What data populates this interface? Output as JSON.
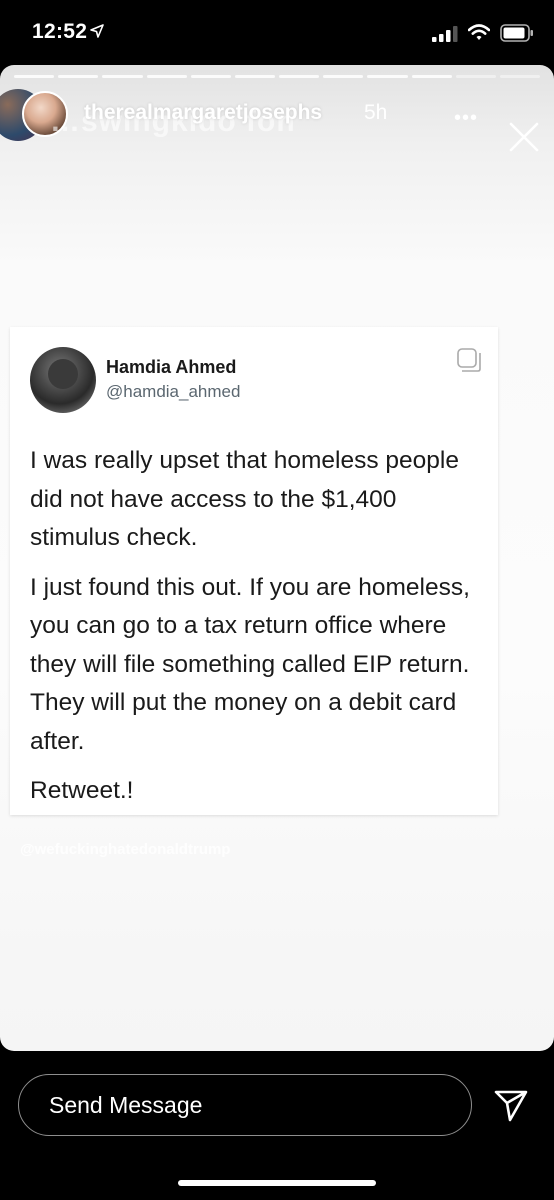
{
  "status_bar": {
    "time": "12:52"
  },
  "story": {
    "username": "therealmargaretjosephs",
    "time_ago": "5h",
    "ghost_text": "…swingkido  fon",
    "segments_total": 12,
    "segments_seen": 10
  },
  "tweet": {
    "name": "Hamdia Ahmed",
    "handle": "@hamdia_ahmed",
    "paragraphs": [
      "I was really upset that homeless people did not have access to the $1,400 stimulus check.",
      "I just found this out. If you are homeless, you can go to a tax return office where they will file something called EIP return. They will put the money on a debit card after.",
      "Retweet.!"
    ]
  },
  "watermark": "@wefuckinghatedonaldtrump",
  "composer": {
    "placeholder": "Send Message"
  },
  "icons": [
    "location-arrow-icon",
    "signal-icon",
    "wifi-icon",
    "battery-icon",
    "more-icon",
    "close-icon",
    "copy-icon",
    "send-icon"
  ]
}
